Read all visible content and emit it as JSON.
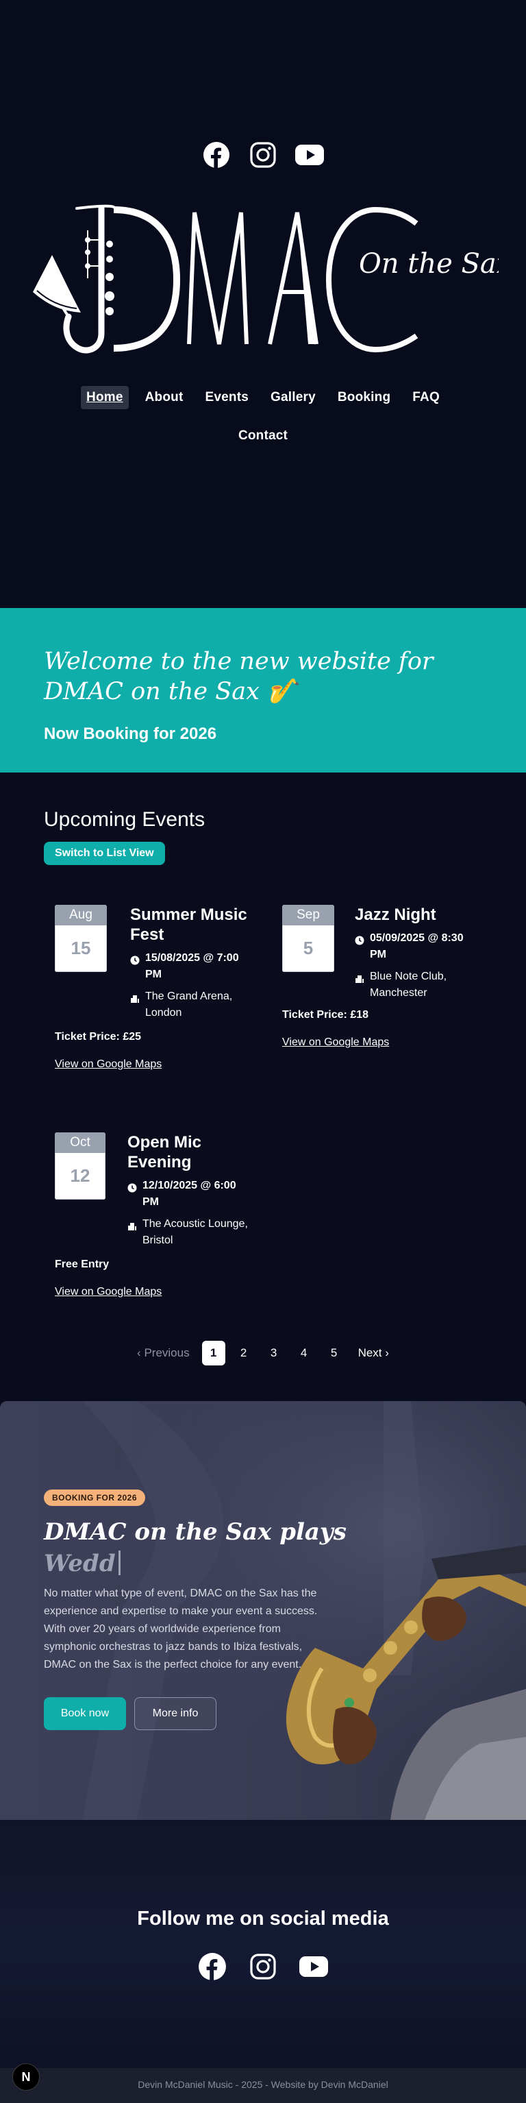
{
  "header": {
    "brand_main": "DMAC",
    "brand_tag": "On the Sax",
    "social_icons": [
      "facebook-icon",
      "instagram-icon",
      "youtube-icon"
    ]
  },
  "nav": {
    "items": [
      {
        "label": "Home",
        "active": true
      },
      {
        "label": "About"
      },
      {
        "label": "Events"
      },
      {
        "label": "Gallery"
      },
      {
        "label": "Booking"
      },
      {
        "label": "FAQ"
      },
      {
        "label": "Contact"
      }
    ]
  },
  "welcome": {
    "title": "Welcome to the new website for DMAC on the Sax 🎷",
    "subtitle": "Now Booking for 2026"
  },
  "events": {
    "title": "Upcoming Events",
    "switch_label": "Switch to List View",
    "items": [
      {
        "month": "Aug",
        "day": "15",
        "title": "Summer Music Fest",
        "datetime": "15/08/2025 @ 7:00 PM",
        "venue": "The Grand Arena, London",
        "price": "Ticket Price: £25",
        "map": "View on Google Maps"
      },
      {
        "month": "Sep",
        "day": "5",
        "title": "Jazz Night",
        "datetime": "05/09/2025 @ 8:30 PM",
        "venue": "Blue Note Club, Manchester",
        "price": "Ticket Price: £18",
        "map": "View on Google Maps"
      },
      {
        "month": "Oct",
        "day": "12",
        "title": "Open Mic Evening",
        "datetime": "12/10/2025 @ 6:00 PM",
        "venue": "The Acoustic Lounge, Bristol",
        "price": "Free Entry",
        "map": "View on Google Maps"
      }
    ],
    "pager": {
      "prev": "Previous",
      "pages": [
        "1",
        "2",
        "3",
        "4",
        "5"
      ],
      "current": "1",
      "next": "Next"
    }
  },
  "booking": {
    "badge": "BOOKING FOR 2026",
    "title": "DMAC on the Sax plays",
    "typed": "Wedd",
    "description": "No matter what type of event, DMAC on the Sax has the experience and expertise to make your event a success. With over 20 years of worldwide experience from symphonic orchestras to jazz bands to Ibiza festivals, DMAC on the Sax is the perfect choice for any event.",
    "book_label": "Book now",
    "more_label": "More info"
  },
  "follow": {
    "title": "Follow me on social media",
    "social_icons": [
      "facebook-icon",
      "instagram-icon",
      "youtube-icon"
    ]
  },
  "footer": {
    "text": "Devin McDaniel Music - 2025 - Website by Devin McDaniel",
    "badge": "N"
  },
  "colors": {
    "background": "#090b1a",
    "accent": "#10aeaa",
    "badge": "#f5b17a"
  }
}
